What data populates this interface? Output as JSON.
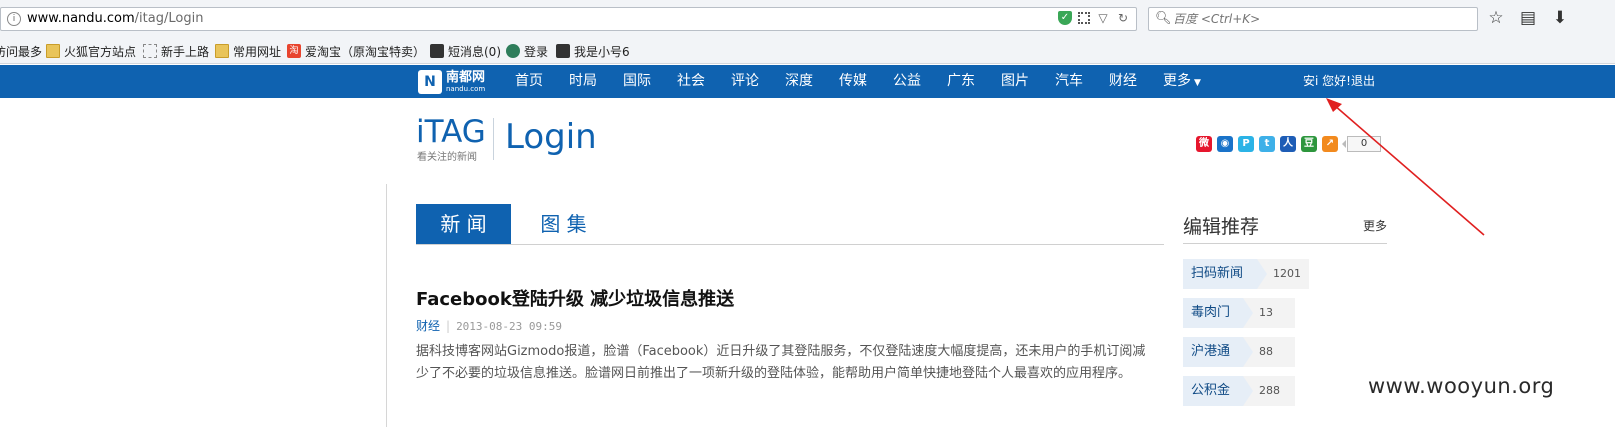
{
  "browser": {
    "url_host": "www.nandu.com",
    "url_path": "/itag/Login",
    "search_placeholder": "百度 <Ctrl+K>",
    "bookmarks": [
      {
        "label": "访问最多",
        "icon": "none"
      },
      {
        "label": "火狐官方站点",
        "icon": "folder-icon"
      },
      {
        "label": "新手上路",
        "icon": "page-icon"
      },
      {
        "label": "常用网址",
        "icon": "folder-icon"
      },
      {
        "label": "爱淘宝（原淘宝特卖）",
        "icon": "taobao-icon"
      },
      {
        "label": "短消息(0)",
        "icon": "user-icon"
      },
      {
        "label": "登录",
        "icon": "globe-icon"
      },
      {
        "label": "我是小号6",
        "icon": "user-icon"
      }
    ]
  },
  "nav": {
    "logo_text": "南都网",
    "logo_sub": "nandu.com",
    "logo_mark": "N",
    "items": [
      "首页",
      "时局",
      "国际",
      "社会",
      "评论",
      "深度",
      "传媒",
      "公益",
      "广东",
      "图片",
      "汽车",
      "财经",
      "更多"
    ],
    "user_greeting": "安i 您好!",
    "logout": "退出"
  },
  "header": {
    "brand": "iTAG",
    "brand_sub": "看关注的新闻",
    "title": "Login",
    "share_count": "0"
  },
  "tabs": [
    {
      "label": "新 闻",
      "active": true
    },
    {
      "label": "图 集",
      "active": false
    }
  ],
  "article": {
    "title": "Facebook登陆升级 减少垃圾信息推送",
    "category": "财经",
    "date": "2013-08-23 09:59",
    "body": "据科技博客网站Gizmodo报道，脸谱（Facebook）近日升级了其登陆服务，不仅登陆速度大幅度提高，还未用户的手机订阅减少了不必要的垃圾信息推送。脸谱网日前推出了一项新升级的登陆体验，能帮助用户简单快捷地登陆个人最喜欢的应用程序。"
  },
  "sidebar": {
    "heading": "编辑推荐",
    "more": "更多",
    "items": [
      {
        "name": "扫码新闻",
        "count": "1201"
      },
      {
        "name": "毒肉门",
        "count": "13"
      },
      {
        "name": "沪港通",
        "count": "88"
      },
      {
        "name": "公积金",
        "count": "288"
      }
    ]
  },
  "watermark": "www.wooyun.org",
  "colors": {
    "brand_blue": "#0f62b0",
    "arrow_red": "#e02020"
  }
}
